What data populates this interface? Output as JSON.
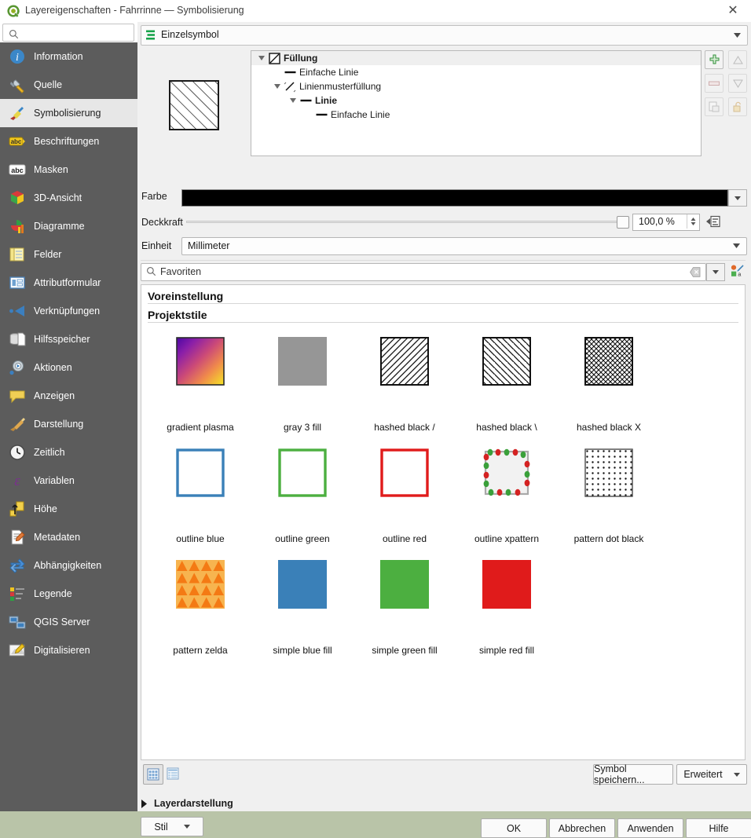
{
  "window": {
    "title": "Layereigenschaften - Fahrrinne — Symbolisierung",
    "close_label": "✕",
    "app_icon": "qgis-logo-icon"
  },
  "sidebar": {
    "search_placeholder": "",
    "search_value": "",
    "items": [
      {
        "label": "Information",
        "icon": "info-icon",
        "selected": false
      },
      {
        "label": "Quelle",
        "icon": "source-wrench-icon",
        "selected": false
      },
      {
        "label": "Symbolisierung",
        "icon": "paintbrush-icon",
        "selected": true
      },
      {
        "label": "Beschriftungen",
        "icon": "abc-label-icon",
        "selected": false
      },
      {
        "label": "Masken",
        "icon": "abc-mask-icon",
        "selected": false
      },
      {
        "label": "3D-Ansicht",
        "icon": "cube-3d-icon",
        "selected": false
      },
      {
        "label": "Diagramme",
        "icon": "chart-icon",
        "selected": false
      },
      {
        "label": "Felder",
        "icon": "fields-table-icon",
        "selected": false
      },
      {
        "label": "Attributformular",
        "icon": "attribute-form-icon",
        "selected": false
      },
      {
        "label": "Verknüpfungen",
        "icon": "joins-icon",
        "selected": false
      },
      {
        "label": "Hilfsspeicher",
        "icon": "auxiliary-storage-icon",
        "selected": false
      },
      {
        "label": "Aktionen",
        "icon": "actions-gear-icon",
        "selected": false
      },
      {
        "label": "Anzeigen",
        "icon": "display-balloon-icon",
        "selected": false
      },
      {
        "label": "Darstellung",
        "icon": "rendering-brush-icon",
        "selected": false
      },
      {
        "label": "Zeitlich",
        "icon": "clock-icon",
        "selected": false
      },
      {
        "label": "Variablen",
        "icon": "variables-epsilon-icon",
        "selected": false
      },
      {
        "label": "Höhe",
        "icon": "elevation-arrow-icon",
        "selected": false
      },
      {
        "label": "Metadaten",
        "icon": "metadata-pencil-icon",
        "selected": false
      },
      {
        "label": "Abhängigkeiten",
        "icon": "dependencies-arrows-icon",
        "selected": false
      },
      {
        "label": "Legende",
        "icon": "legend-icon",
        "selected": false
      },
      {
        "label": "QGIS Server",
        "icon": "server-icon",
        "selected": false
      },
      {
        "label": "Digitalisieren",
        "icon": "digitizing-pencil-icon",
        "selected": false
      }
    ]
  },
  "renderer": {
    "selected": "Einzelsymbol",
    "icon": "single-symbol-icon"
  },
  "symbol_tree": {
    "rows": [
      {
        "label": "Füllung",
        "depth": 0,
        "bold": true,
        "expander": true,
        "icon": "fill-hatch-icon",
        "header": true
      },
      {
        "label": "Einfache Linie",
        "depth": 1,
        "bold": false,
        "expander": false,
        "icon": "simple-line-icon",
        "header": false
      },
      {
        "label": "Linienmusterfüllung",
        "depth": 1,
        "bold": false,
        "expander": true,
        "icon": "line-pattern-fill-icon",
        "header": false
      },
      {
        "label": "Linie",
        "depth": 2,
        "bold": true,
        "expander": true,
        "icon": "simple-line-icon",
        "header": false
      },
      {
        "label": "Einfache Linie",
        "depth": 3,
        "bold": false,
        "expander": false,
        "icon": "simple-line-icon",
        "header": false
      }
    ],
    "buttons": [
      {
        "name": "add-symbol-layer-button",
        "icon": "plus-green-icon",
        "enabled": true
      },
      {
        "name": "move-up-button",
        "icon": "arrow-up-icon",
        "enabled": false
      },
      {
        "name": "remove-symbol-layer-button",
        "icon": "minus-icon",
        "enabled": false
      },
      {
        "name": "move-down-button",
        "icon": "arrow-down-icon",
        "enabled": false
      },
      {
        "name": "duplicate-button",
        "icon": "duplicate-icon",
        "enabled": false
      },
      {
        "name": "lock-button",
        "icon": "lock-open-icon",
        "enabled": false
      }
    ]
  },
  "properties": {
    "color_label": "Farbe",
    "color_value": "#000000",
    "opacity_label": "Deckkraft",
    "opacity_value": "100,0 %",
    "opacity_percent": 100,
    "unit_label": "Einheit",
    "unit_value": "Millimeter"
  },
  "favorites": {
    "text": "Favoriten",
    "search_icon": "search-icon",
    "clear_icon": "clear-icon",
    "dropdown_icon": "chevron-down-icon",
    "style_manager_icon": "style-manager-icon"
  },
  "gallery": {
    "groups": [
      {
        "title": "Voreinstellung",
        "items": []
      },
      {
        "title": "Projektstile",
        "items": [
          {
            "label": "gradient  plasma",
            "swatch": "gradient-plasma"
          },
          {
            "label": "gray 3 fill",
            "swatch": "gray3"
          },
          {
            "label": "hashed black /",
            "swatch": "hatch-fwd"
          },
          {
            "label": "hashed black \\",
            "swatch": "hatch-back"
          },
          {
            "label": "hashed black X",
            "swatch": "hatch-cross"
          },
          {
            "label": "outline blue",
            "swatch": "outline-blue"
          },
          {
            "label": "outline green",
            "swatch": "outline-green"
          },
          {
            "label": "outline red",
            "swatch": "outline-red"
          },
          {
            "label": "outline xpattern",
            "swatch": "outline-xpattern"
          },
          {
            "label": "pattern dot black",
            "swatch": "dot-black"
          },
          {
            "label": "pattern zelda",
            "swatch": "zelda"
          },
          {
            "label": "simple blue fill",
            "swatch": "blue-fill"
          },
          {
            "label": "simple green fill",
            "swatch": "green-fill"
          },
          {
            "label": "simple red fill",
            "swatch": "red-fill"
          }
        ]
      }
    ],
    "view_icon_grid": "grid-view-icon",
    "view_icon_list": "list-view-icon",
    "save_symbol_label": "Symbol speichern...",
    "advanced_label": "Erweitert"
  },
  "footer": {
    "layer_rendering_label": "Layerdarstellung",
    "style_label": "Stil",
    "ok_label": "OK",
    "cancel_label": "Abbrechen",
    "apply_label": "Anwenden",
    "help_label": "Hilfe"
  },
  "colors": {
    "sidebar_bg": "#5c5c5c",
    "sidebar_selected_bg": "#e7e7e7",
    "pane_bg": "#f0f0f0",
    "blue": "#3a80b8",
    "green": "#4caf40",
    "red": "#e01b1b",
    "orange": "#f57c0a"
  }
}
